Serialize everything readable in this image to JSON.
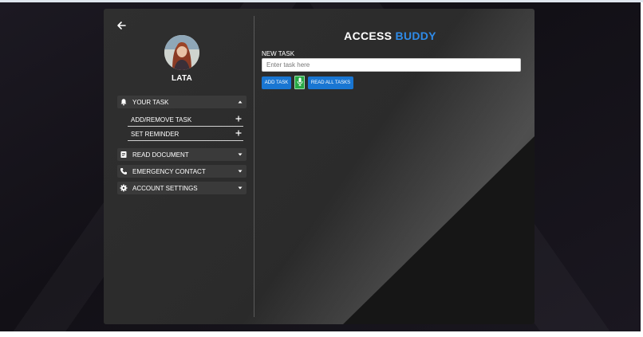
{
  "app": {
    "title_part1": "ACCESS",
    "title_part2": "BUDDY",
    "brand_color": "#2f8be8",
    "accent_button_color": "#1976d2",
    "mic_button_color": "#27a844"
  },
  "navigation": {
    "back_icon": "arrow-left-icon"
  },
  "profile": {
    "name": "LATA",
    "avatar_icon": "user-photo"
  },
  "sidebar": {
    "sections": [
      {
        "label": "YOUR TASK",
        "icon": "bell-icon",
        "caret": "caret-up-icon",
        "expanded": true,
        "subitems": [
          {
            "label": "ADD/REMOVE TASK",
            "icon": "plus-icon"
          },
          {
            "label": "SET REMINDER",
            "icon": "plus-icon"
          }
        ]
      },
      {
        "label": "READ DOCUMENT",
        "icon": "document-icon",
        "caret": "caret-down-icon",
        "expanded": false
      },
      {
        "label": "EMERGENCY CONTACT",
        "icon": "phone-icon",
        "caret": "caret-down-icon",
        "expanded": false
      },
      {
        "label": "ACCOUNT SETTINGS",
        "icon": "gear-icon",
        "caret": "caret-down-icon",
        "expanded": false
      }
    ]
  },
  "task_form": {
    "label": "NEW TASK",
    "input_value": "",
    "input_placeholder": "Enter task here",
    "add_button": "ADD TASK",
    "mic_icon": "microphone-icon",
    "read_all_button": "READ ALL TASKS"
  }
}
